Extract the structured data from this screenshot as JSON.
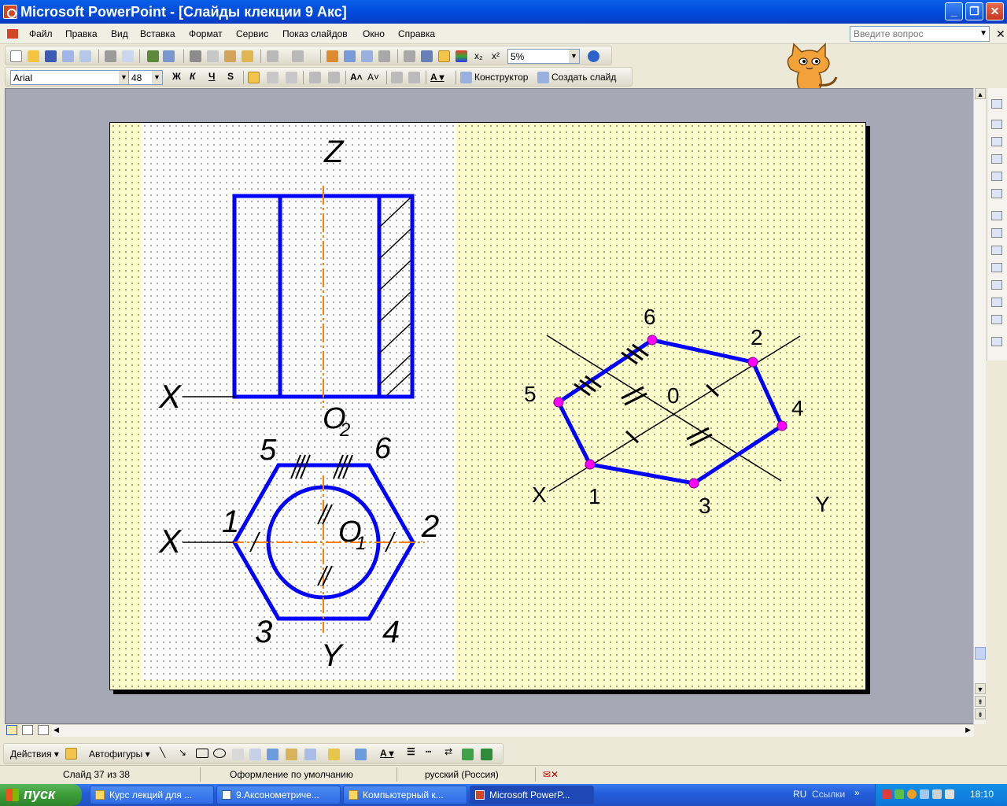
{
  "window": {
    "title": "Microsoft PowerPoint - [Слайды клекции 9 Акс]"
  },
  "menu": {
    "items": [
      "Файл",
      "Правка",
      "Вид",
      "Вставка",
      "Формат",
      "Сервис",
      "Показ слайдов",
      "Окно",
      "Справка"
    ],
    "help_placeholder": "Введите вопрос"
  },
  "toolbar": {
    "zoom": "5%",
    "font_name": "Arial",
    "font_size": "48",
    "bold_label": "Ж",
    "italic_label": "К",
    "underline_label": "Ч",
    "shadow_label": "S",
    "designer_label": "Конструктор",
    "new_slide_label": "Создать слайд"
  },
  "slide": {
    "left_labels": {
      "z": "Z",
      "x_top": "X",
      "o2": "O",
      "o2_sub": "2",
      "n5": "5",
      "n6": "6",
      "n1": "1",
      "n2": "2",
      "x_bottom": "X",
      "o1": "O",
      "o1_sub": "1",
      "n3": "3",
      "n4": "4",
      "y": "Y"
    },
    "right_labels": {
      "n6": "6",
      "n2": "2",
      "n5": "5",
      "zero": "0",
      "n4": "4",
      "x": "X",
      "n1": "1",
      "n3": "3",
      "y": "Y"
    },
    "colors": {
      "outline": "#0000FF",
      "axis": "#FF8000",
      "vertex": "#FF00FF",
      "background": "#FFFFCC"
    }
  },
  "drawbar": {
    "actions_label": "Действия",
    "autoshapes_label": "Автофигуры"
  },
  "status": {
    "slide_counter": "Слайд 37 из 38",
    "design": "Оформление по умолчанию",
    "language": "русский (Россия)"
  },
  "taskbar": {
    "start_label": "пуск",
    "items": [
      "Курс лекций для ...",
      "9.Аксонометриче...",
      "Компьютерный к...",
      "Microsoft PowerP..."
    ],
    "lang": "RU",
    "links": "Ссылки",
    "clock": "18:10"
  }
}
